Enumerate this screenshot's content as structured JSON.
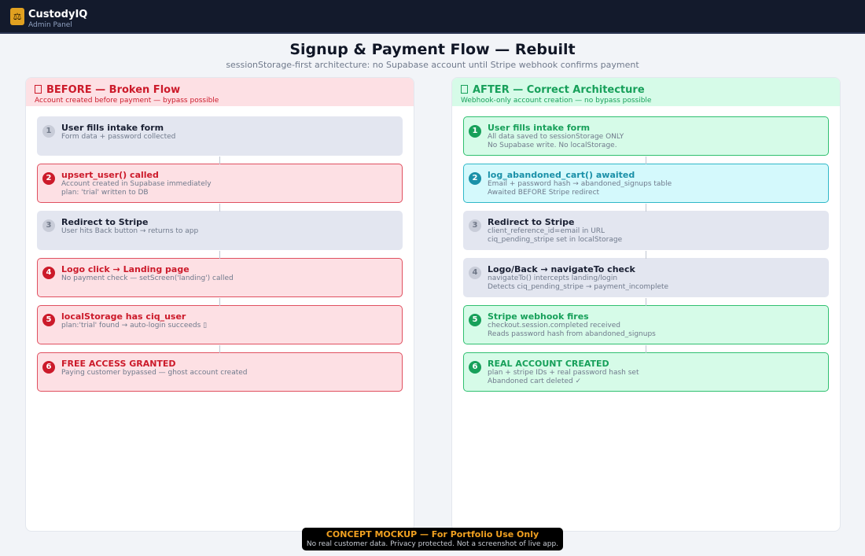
{
  "header": {
    "brand": "CustodyIQ",
    "subtitle": "Admin Panel"
  },
  "page": {
    "title": "Signup & Payment Flow — Rebuilt",
    "subtitle": "sessionStorage-first architecture: no Supabase account until Stripe webhook confirms payment"
  },
  "before": {
    "title": "BEFORE — Broken Flow",
    "subtitle": "Account created before payment — bypass possible",
    "steps": [
      {
        "num": "1",
        "title": "User fills intake form",
        "line1": "Form data + password collected",
        "line2": ""
      },
      {
        "num": "2",
        "title": "upsert_user() called",
        "line1": "Account created in Supabase immediately",
        "line2": "plan: 'trial' written to DB"
      },
      {
        "num": "3",
        "title": "Redirect to Stripe",
        "line1": "User hits Back button → returns to app",
        "line2": ""
      },
      {
        "num": "4",
        "title": "Logo click → Landing page",
        "line1": "No payment check — setScreen('landing') called",
        "line2": ""
      },
      {
        "num": "5",
        "title": "localStorage has ciq_user",
        "line1": "plan:'trial' found → auto-login succeeds ▯",
        "line2": ""
      },
      {
        "num": "6",
        "title": "FREE ACCESS GRANTED",
        "line1": "Paying customer bypassed — ghost account created",
        "line2": ""
      }
    ]
  },
  "after": {
    "title": "AFTER — Correct Architecture",
    "subtitle": "Webhook-only account creation — no bypass possible",
    "steps": [
      {
        "num": "1",
        "title": "User fills intake form",
        "line1": "All data saved to sessionStorage ONLY",
        "line2": "No Supabase write. No localStorage."
      },
      {
        "num": "2",
        "title": "log_abandoned_cart() awaited",
        "line1": "Email + password hash → abandoned_signups table",
        "line2": "Awaited BEFORE Stripe redirect"
      },
      {
        "num": "3",
        "title": "Redirect to Stripe",
        "line1": "client_reference_id=email in URL",
        "line2": "ciq_pending_stripe set in localStorage"
      },
      {
        "num": "4",
        "title": "Logo/Back → navigateTo check",
        "line1": "navigateTo() intercepts landing/login",
        "line2": "Detects ciq_pending_stripe → payment_incomplete"
      },
      {
        "num": "5",
        "title": "Stripe webhook fires",
        "line1": "checkout.session.completed received",
        "line2": "Reads password hash from abandoned_signups"
      },
      {
        "num": "6",
        "title": "REAL ACCOUNT CREATED",
        "line1": "plan + stripe IDs + real password hash set",
        "line2": "Abandoned cart deleted ✓"
      }
    ]
  },
  "footer": {
    "title": "CONCEPT MOCKUP — For Portfolio Use Only",
    "subtitle": "No real customer data. Privacy protected. Not a screenshot of live app."
  },
  "icons": {
    "brand": "scales-icon",
    "before_status": "missing-glyph-icon",
    "after_status": "missing-glyph-icon"
  },
  "colors": {
    "topbar": "#131a2c",
    "brand_badge": "#e0a020",
    "error": "#cc1a2a",
    "success": "#17a05a",
    "info": "#1a90a8",
    "footer_accent": "#f0a020"
  }
}
